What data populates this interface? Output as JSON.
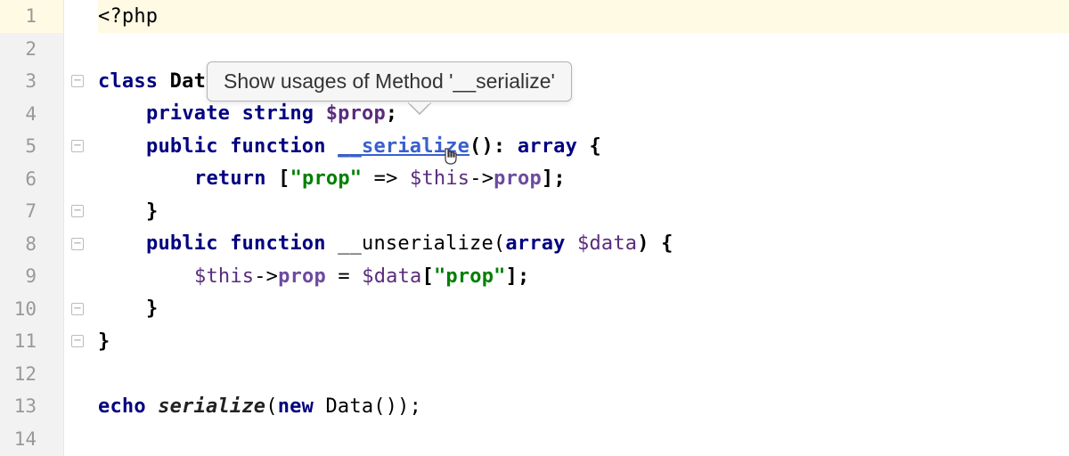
{
  "tooltip": {
    "text": "Show usages of Method '__serialize'"
  },
  "gutter": {
    "lines": [
      "1",
      "2",
      "3",
      "4",
      "5",
      "6",
      "7",
      "8",
      "9",
      "10",
      "11",
      "12",
      "13",
      "14"
    ],
    "highlighted": 1
  },
  "code": {
    "l1": {
      "open": "<?php"
    },
    "l3": {
      "kw_class": "class",
      "name": " Data {"
    },
    "l4": {
      "kw1": "private",
      "kw2": " string ",
      "var": "$prop",
      "semi": ";"
    },
    "l5": {
      "kw1": "public",
      "kw2": " function ",
      "name": "__serialize",
      "sig": "(): ",
      "kw3": "array",
      "brace": " {"
    },
    "l6": {
      "kw": "return",
      "lb": " [",
      "str": "\"prop\"",
      "arrow": " => ",
      "this": "$this",
      "deref": "->",
      "prop": "prop",
      "rb": "];"
    },
    "l7": {
      "brace": "}"
    },
    "l8": {
      "kw1": "public",
      "kw2": " function ",
      "name": "__unserialize(",
      "kw3": "array ",
      "var": "$data",
      "close": ") {"
    },
    "l9": {
      "this": "$this",
      "deref": "->",
      "prop": "prop",
      "eq": " = ",
      "var": "$data",
      "lb": "[",
      "str": "\"prop\"",
      "rb": "];"
    },
    "l10": {
      "brace": "}"
    },
    "l11": {
      "brace": "}"
    },
    "l13": {
      "kw": "echo ",
      "fn": "serialize",
      "open": "(",
      "new": "new",
      "call": " Data());"
    }
  }
}
